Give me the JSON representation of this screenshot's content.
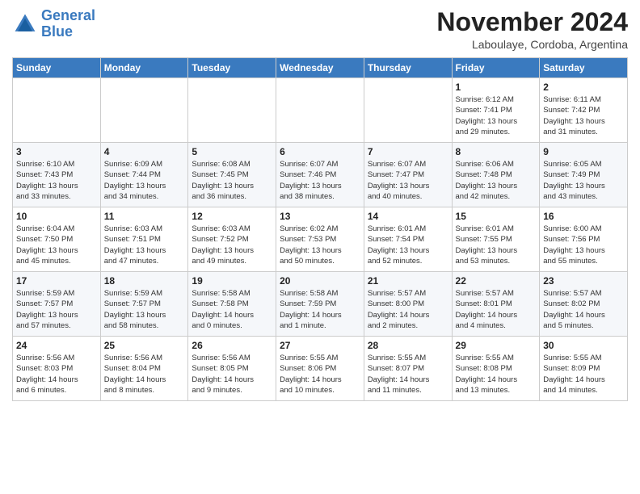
{
  "header": {
    "logo_line1": "General",
    "logo_line2": "Blue",
    "month": "November 2024",
    "location": "Laboulaye, Cordoba, Argentina"
  },
  "days_of_week": [
    "Sunday",
    "Monday",
    "Tuesday",
    "Wednesday",
    "Thursday",
    "Friday",
    "Saturday"
  ],
  "weeks": [
    [
      {
        "day": "",
        "detail": ""
      },
      {
        "day": "",
        "detail": ""
      },
      {
        "day": "",
        "detail": ""
      },
      {
        "day": "",
        "detail": ""
      },
      {
        "day": "",
        "detail": ""
      },
      {
        "day": "1",
        "detail": "Sunrise: 6:12 AM\nSunset: 7:41 PM\nDaylight: 13 hours\nand 29 minutes."
      },
      {
        "day": "2",
        "detail": "Sunrise: 6:11 AM\nSunset: 7:42 PM\nDaylight: 13 hours\nand 31 minutes."
      }
    ],
    [
      {
        "day": "3",
        "detail": "Sunrise: 6:10 AM\nSunset: 7:43 PM\nDaylight: 13 hours\nand 33 minutes."
      },
      {
        "day": "4",
        "detail": "Sunrise: 6:09 AM\nSunset: 7:44 PM\nDaylight: 13 hours\nand 34 minutes."
      },
      {
        "day": "5",
        "detail": "Sunrise: 6:08 AM\nSunset: 7:45 PM\nDaylight: 13 hours\nand 36 minutes."
      },
      {
        "day": "6",
        "detail": "Sunrise: 6:07 AM\nSunset: 7:46 PM\nDaylight: 13 hours\nand 38 minutes."
      },
      {
        "day": "7",
        "detail": "Sunrise: 6:07 AM\nSunset: 7:47 PM\nDaylight: 13 hours\nand 40 minutes."
      },
      {
        "day": "8",
        "detail": "Sunrise: 6:06 AM\nSunset: 7:48 PM\nDaylight: 13 hours\nand 42 minutes."
      },
      {
        "day": "9",
        "detail": "Sunrise: 6:05 AM\nSunset: 7:49 PM\nDaylight: 13 hours\nand 43 minutes."
      }
    ],
    [
      {
        "day": "10",
        "detail": "Sunrise: 6:04 AM\nSunset: 7:50 PM\nDaylight: 13 hours\nand 45 minutes."
      },
      {
        "day": "11",
        "detail": "Sunrise: 6:03 AM\nSunset: 7:51 PM\nDaylight: 13 hours\nand 47 minutes."
      },
      {
        "day": "12",
        "detail": "Sunrise: 6:03 AM\nSunset: 7:52 PM\nDaylight: 13 hours\nand 49 minutes."
      },
      {
        "day": "13",
        "detail": "Sunrise: 6:02 AM\nSunset: 7:53 PM\nDaylight: 13 hours\nand 50 minutes."
      },
      {
        "day": "14",
        "detail": "Sunrise: 6:01 AM\nSunset: 7:54 PM\nDaylight: 13 hours\nand 52 minutes."
      },
      {
        "day": "15",
        "detail": "Sunrise: 6:01 AM\nSunset: 7:55 PM\nDaylight: 13 hours\nand 53 minutes."
      },
      {
        "day": "16",
        "detail": "Sunrise: 6:00 AM\nSunset: 7:56 PM\nDaylight: 13 hours\nand 55 minutes."
      }
    ],
    [
      {
        "day": "17",
        "detail": "Sunrise: 5:59 AM\nSunset: 7:57 PM\nDaylight: 13 hours\nand 57 minutes."
      },
      {
        "day": "18",
        "detail": "Sunrise: 5:59 AM\nSunset: 7:57 PM\nDaylight: 13 hours\nand 58 minutes."
      },
      {
        "day": "19",
        "detail": "Sunrise: 5:58 AM\nSunset: 7:58 PM\nDaylight: 14 hours\nand 0 minutes."
      },
      {
        "day": "20",
        "detail": "Sunrise: 5:58 AM\nSunset: 7:59 PM\nDaylight: 14 hours\nand 1 minute."
      },
      {
        "day": "21",
        "detail": "Sunrise: 5:57 AM\nSunset: 8:00 PM\nDaylight: 14 hours\nand 2 minutes."
      },
      {
        "day": "22",
        "detail": "Sunrise: 5:57 AM\nSunset: 8:01 PM\nDaylight: 14 hours\nand 4 minutes."
      },
      {
        "day": "23",
        "detail": "Sunrise: 5:57 AM\nSunset: 8:02 PM\nDaylight: 14 hours\nand 5 minutes."
      }
    ],
    [
      {
        "day": "24",
        "detail": "Sunrise: 5:56 AM\nSunset: 8:03 PM\nDaylight: 14 hours\nand 6 minutes."
      },
      {
        "day": "25",
        "detail": "Sunrise: 5:56 AM\nSunset: 8:04 PM\nDaylight: 14 hours\nand 8 minutes."
      },
      {
        "day": "26",
        "detail": "Sunrise: 5:56 AM\nSunset: 8:05 PM\nDaylight: 14 hours\nand 9 minutes."
      },
      {
        "day": "27",
        "detail": "Sunrise: 5:55 AM\nSunset: 8:06 PM\nDaylight: 14 hours\nand 10 minutes."
      },
      {
        "day": "28",
        "detail": "Sunrise: 5:55 AM\nSunset: 8:07 PM\nDaylight: 14 hours\nand 11 minutes."
      },
      {
        "day": "29",
        "detail": "Sunrise: 5:55 AM\nSunset: 8:08 PM\nDaylight: 14 hours\nand 13 minutes."
      },
      {
        "day": "30",
        "detail": "Sunrise: 5:55 AM\nSunset: 8:09 PM\nDaylight: 14 hours\nand 14 minutes."
      }
    ]
  ]
}
